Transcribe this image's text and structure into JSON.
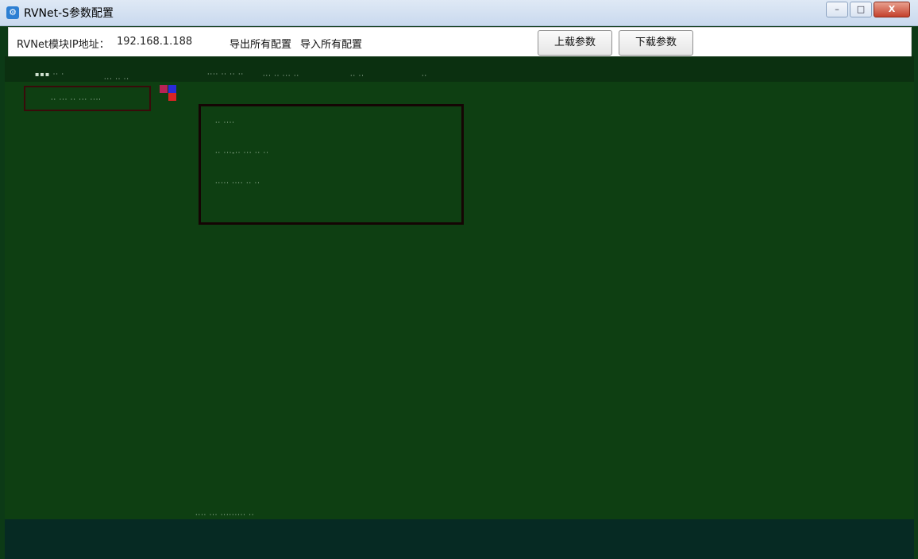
{
  "window": {
    "title": "RVNet-S参数配置",
    "controls": {
      "minimize": "–",
      "maximize": "□",
      "close": "X"
    }
  },
  "toolbar": {
    "ip_label": "RVNet模块IP地址：",
    "ip_value": "192.168.1.188",
    "export_all": "导出所有配置",
    "import_all": "导入所有配置",
    "upload_params": "上载参数",
    "download_params": "下载参数"
  },
  "colors": {
    "background": "#0e3f12",
    "titlebar": "#c9d9ee",
    "toolbar": "#ffffff"
  }
}
